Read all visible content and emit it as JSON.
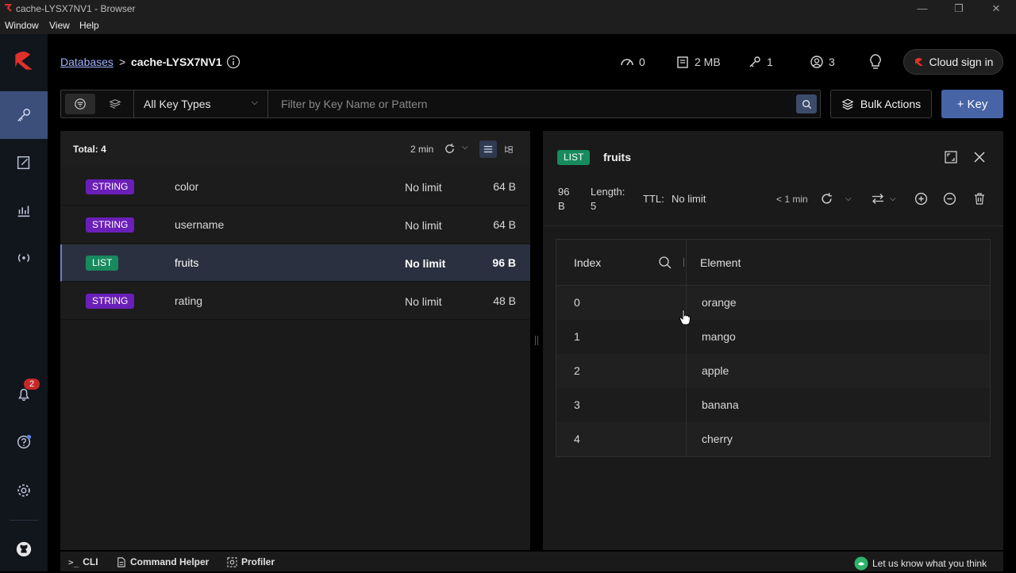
{
  "window": {
    "title": "cache-LYSX7NV1 - Browser",
    "minimize": "—",
    "restore": "❐",
    "close": "✕"
  },
  "menu": [
    "Window",
    "View",
    "Help"
  ],
  "breadcrumb": {
    "databases": "Databases",
    "separator": ">",
    "current": "cache-LYSX7NV1"
  },
  "stats": {
    "ops": "0",
    "memory": "2 MB",
    "keys": "1",
    "clients": "3"
  },
  "cloud_signin": "Cloud sign in",
  "filter": {
    "key_type": "All Key Types",
    "placeholder": "Filter by Key Name or Pattern"
  },
  "bulk_actions": "Bulk Actions",
  "add_key": "+ Key",
  "keylist": {
    "total": "Total: 4",
    "refresh_age": "2 min",
    "rows": [
      {
        "type": "STRING",
        "name": "color",
        "ttl": "No limit",
        "size": "64 B"
      },
      {
        "type": "STRING",
        "name": "username",
        "ttl": "No limit",
        "size": "64 B"
      },
      {
        "type": "LIST",
        "name": "fruits",
        "ttl": "No limit",
        "size": "96 B"
      },
      {
        "type": "STRING",
        "name": "rating",
        "ttl": "No limit",
        "size": "48 B"
      }
    ]
  },
  "detail": {
    "type": "LIST",
    "name": "fruits",
    "size_num": "96",
    "size_unit": "B",
    "length_label": "Length:",
    "length_value": "5",
    "ttl_label": "TTL:",
    "ttl_value": "No limit",
    "refresh_age": "< 1 min",
    "columns": {
      "index": "Index",
      "element": "Element"
    },
    "rows": [
      {
        "index": "0",
        "element": "orange"
      },
      {
        "index": "1",
        "element": "mango"
      },
      {
        "index": "2",
        "element": "apple"
      },
      {
        "index": "3",
        "element": "banana"
      },
      {
        "index": "4",
        "element": "cherry"
      }
    ]
  },
  "notifications_count": "2",
  "bottombar": {
    "cli": "CLI",
    "cli_prompt": ">_",
    "command_helper": "Command Helper",
    "profiler": "Profiler",
    "feedback": "Let us know what you think"
  },
  "colors": {
    "accent": "#4764a6",
    "string_badge": "#6a1fb8",
    "list_badge": "#178a5e",
    "brand": "#e0302a"
  }
}
